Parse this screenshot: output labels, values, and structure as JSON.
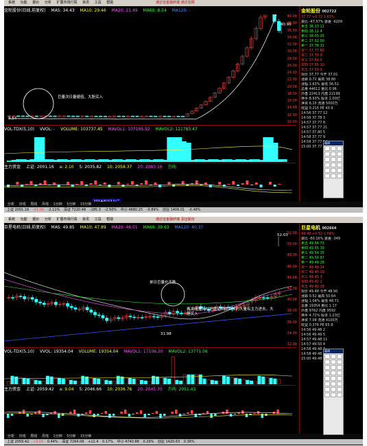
{
  "top": {
    "menu": [
      "系统",
      "功能",
      "报价",
      "分析",
      "扩展市场行情",
      "资讯",
      "工具",
      "帮助"
    ],
    "center_title": "通达信金融终端  通达信网",
    "ma": {
      "title": "金轮股份(日线,前复权)",
      "ma5": "MA5: 34.43",
      "ma10": "MA10: 29.46",
      "ma20": "MA20: 21.49",
      "ma60": "MA60: 8.54",
      "ma120": "MA120: -"
    },
    "price_high": "40.96",
    "price_low": "8.54",
    "annotation": "巨量次日量缩倍，大胆买入",
    "volume_bar": {
      "name": "VOL-TDX(5,10)",
      "vvol": "VVOL: -",
      "volume": "VOLUME: 103737.45",
      "mavol1": "MAVOL1: 107195.92",
      "mavol2": "MAVOL2: 121783.47"
    },
    "indicator_bar": {
      "name": "主力资金",
      "a": "上证: 2001.16",
      "b": "a: 2.10",
      "c": "5: 2035.82",
      "d": "10: 2058.37",
      "e": "20: 2083.16",
      "f": "方向:"
    },
    "date_label": "2014/02/11/二",
    "vscale_price": [
      "40.00",
      "38.00",
      "36.00",
      "34.00",
      "32.00",
      "30.00",
      "28.00",
      "26.00",
      "24.00",
      "22.00",
      "20.00",
      "18.00",
      "16.00",
      "14.00",
      "12.00",
      "10.00"
    ],
    "vscale_vol": [
      "1000",
      "800",
      "600",
      "400",
      "200"
    ],
    "sidebar": {
      "title": "金轮股份",
      "code": "002722",
      "price": "37.77",
      "change": "+0.72",
      "pct": "1.63%",
      "rows": [
        "委比  -47.57%  委差  -6209",
        "卖五  38.23  12",
        "卖四  38.11  4",
        "卖三  38.05  25",
        "卖二  37.92  50",
        "卖一  37.78  31",
        "买一  37.77  80",
        "买二  37.70  9",
        "买三  37.60  5",
        "买四  37.55  10",
        "买五  37.50  3",
        "现价  37.77  今开  37.01",
        "涨跌  0.72  最高  38.80",
        "涨幅  1.63%  最低  36.51",
        "总量  44612  量比  0.96",
        "外盘  22413  内盘  22199",
        "换手  8.93%  股本  2.00亿",
        "净资  6.15  流通  5000万",
        "收益  0.215  PE  43.9"
      ],
      "ticks": [
        "14:56  37.77  12",
        "14:56  37.78  3",
        "14:57  37.77  8",
        "14:57  37.77  21",
        "14:57  37.80  5",
        "14:58  37.77  9",
        "14:58  37.77  14",
        "15:00  37.77  66"
      ]
    },
    "tabs": [
      "分析",
      "日线",
      "周线",
      "月线",
      "1分钟",
      "5分钟",
      "15分钟"
    ],
    "status": [
      "上证  2001.16",
      "-43.08",
      "-2.11%",
      "深证  7220.48",
      "-185.3",
      "-2.50%",
      "中小  4680.25",
      "-0.89%",
      "创业  1406.01",
      "-0.48%"
    ]
  },
  "bottom": {
    "menu": [
      "系统",
      "功能",
      "报价",
      "分析",
      "扩展市场行情",
      "资讯",
      "工具",
      "帮助"
    ],
    "center_title": "通达信金融终端  深证股份",
    "ma": {
      "title": "巨星电机(日线,前复权)",
      "ma5": "MA5: 49.85",
      "ma10": "MA10: 47.89",
      "ma20": "MA20: 46.01",
      "ma60": "MA60: 39.63",
      "ma120": "MA120: 40.37"
    },
    "price_high": "52.03",
    "price_low": "31.98",
    "annotation1": "单日巨量价不跌",
    "annotation2": "再次缩量后在护盘证明前面放的大量有主力进去，大胆买入",
    "volume_bar": {
      "name": "VOL-TDX(5,10)",
      "vvol": "VVOL: 19354.04",
      "volume": "VOLUME: 19354.04",
      "mavol1": "MAVOL1: 17106.20",
      "mavol2": "MAVOL2: 13771.06"
    },
    "indicator_bar": {
      "name": "主力资金",
      "a": "上证: 2059.42",
      "b": "a: 9.04",
      "c": "5: 2046.66",
      "d": "10: 2036.76",
      "e": "20: 2045.35",
      "f": "方向: 2051.43"
    },
    "vscale_price": [
      "52.00",
      "50.00",
      "48.00",
      "46.00",
      "44.00",
      "42.00",
      "40.00",
      "38.00",
      "36.00",
      "34.00",
      "32.00"
    ],
    "vscale_vol": [
      "100",
      "80",
      "60",
      "40",
      "20"
    ],
    "sidebar": {
      "title": "巨星电机",
      "code": "002664",
      "price": "49.48",
      "change": "+0.52",
      "pct": "1.04%",
      "rows": [
        "委比  -60.16%  委差  -349",
        "卖五  49.56  73",
        "卖四  49.55  30",
        "卖三  49.54  15",
        "卖二  49.50  87",
        "卖一  49.49  28",
        "买一  49.48  14",
        "买二  49.45  10",
        "买三  49.43  3",
        "买四  49.42  2",
        "买五  49.40  18",
        "现价  49.48  今开  48.90",
        "涨跌  0.52  最高  50.64",
        "涨幅  1.04%  最低  48.71",
        "总量  19354  量比  1.17",
        "外盘  9762  内盘  9592",
        "换手  4.72%  股本  1.23亿",
        "净资  7.08  流通  4100万",
        "收益  0.376  PE  65.8"
      ],
      "ticks": [
        "14:56  49.48  2",
        "14:56  49.49  5",
        "14:57  49.48  11",
        "14:57  49.50  4",
        "14:58  49.48  7",
        "14:58  49.48  3",
        "15:00  49.48  41"
      ]
    },
    "tabs": [
      "分析",
      "日线",
      "周线",
      "月线",
      "1分钟",
      "5分钟",
      "15分钟"
    ],
    "status": [
      "上证  2059.42",
      "+9.04",
      "0.44%",
      "深证  7264.06",
      "+12.4",
      "0.17%",
      "中小  4740.88",
      "0.29%",
      "创业  1420.63",
      "0.36%"
    ]
  },
  "colors": {
    "up": "#ff4444",
    "down": "#33ffff",
    "ma5": "#ffffff",
    "ma10": "#ffff33",
    "ma20": "#ff55ff",
    "ma60": "#33ff33",
    "ma120": "#5588ff"
  }
}
